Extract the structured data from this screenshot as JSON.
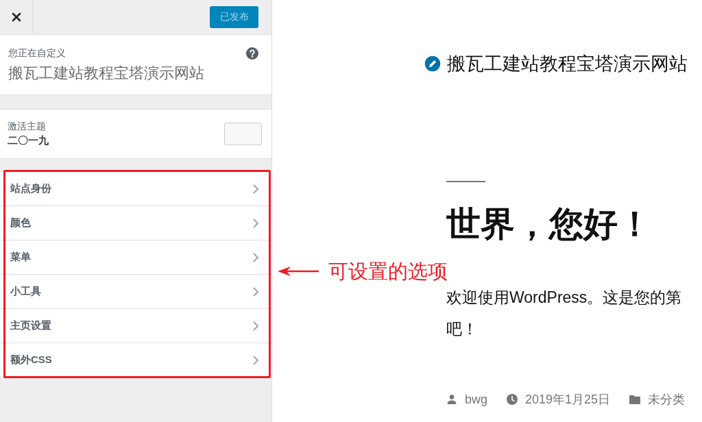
{
  "customizer": {
    "publish_button": {
      "label": "已发布",
      "disabled": true
    },
    "info": {
      "caption": "您正在自定义",
      "site_title": "搬瓦工建站教程宝塔演示网站"
    },
    "active_theme": {
      "caption": "激活主题",
      "name": "二〇一九"
    },
    "sections": [
      {
        "label": "站点身份"
      },
      {
        "label": "颜色"
      },
      {
        "label": "菜单"
      },
      {
        "label": "小工具"
      },
      {
        "label": "主页设置"
      },
      {
        "label": "额外CSS"
      }
    ]
  },
  "annotation": {
    "text": "可设置的选项"
  },
  "preview": {
    "site_title": "搬瓦工建站教程宝塔演示网站",
    "post": {
      "title": "世界，您好！",
      "lines": [
        "欢迎使用WordPress。这是您的第",
        "吧！"
      ],
      "meta": [
        {
          "kind": "author",
          "text": "bwg"
        },
        {
          "kind": "date",
          "text": "2019年1月25日"
        },
        {
          "kind": "category",
          "text": "未分类"
        }
      ]
    }
  }
}
